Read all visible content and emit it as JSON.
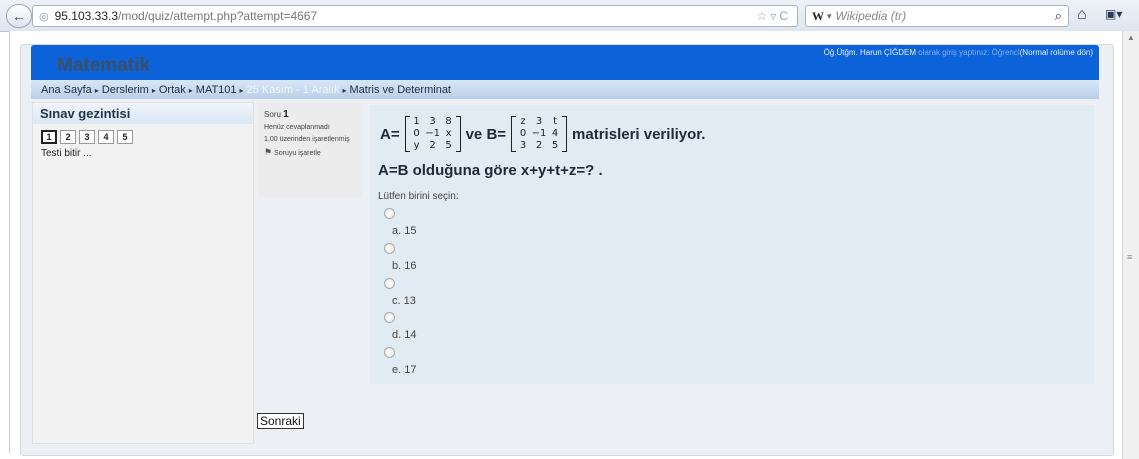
{
  "browser": {
    "url_host": "95.103.33.3",
    "url_path": "/mod/quiz/attempt.php?attempt=4667",
    "search_engine": "W",
    "search_placeholder": "Wikipedia (tr)"
  },
  "site": {
    "title": "Matematik",
    "login_user": "Öğ.Ütğm. Harun ÇİĞDEM",
    "login_mid": " olarak giriş yaptınız: Öğrenci",
    "login_role": "(Normal rolüme dön)"
  },
  "breadcrumb": {
    "items": [
      "Ana Sayfa",
      "Derslerim",
      "Ortak",
      "MAT101",
      "25 Kasım - 1 Aralık",
      "Matris ve Determinat"
    ]
  },
  "quiz_nav": {
    "title": "Sınav gezintisi",
    "pages": [
      "1",
      "2",
      "3",
      "4",
      "5"
    ],
    "current": "1",
    "finish_label": "Testi bitir ..."
  },
  "question_info": {
    "label": "Soru",
    "number": "1",
    "status": "Henüz cevaplanmadı",
    "mark": "1,00 üzerinden işaretlenmiş",
    "flag_label": "Soruyu işaretle"
  },
  "question": {
    "a_label": "A=",
    "matrix_a": [
      "1",
      "3",
      "8",
      "0",
      "−1",
      "x",
      "y",
      "2",
      "5"
    ],
    "connector": "ve B=",
    "matrix_b": [
      "z",
      "3",
      "t",
      "0",
      "−1",
      "4",
      "3",
      "2",
      "5"
    ],
    "suffix": "matrisleri veriliyor.",
    "line2": "A=B olduğuna göre x+y+t+z=? .",
    "prompt": "Lütfen birini seçin:",
    "options": [
      "a. 15",
      "b. 16",
      "c. 13",
      "d. 14",
      "e. 17"
    ]
  },
  "next_button": "Sonraki"
}
